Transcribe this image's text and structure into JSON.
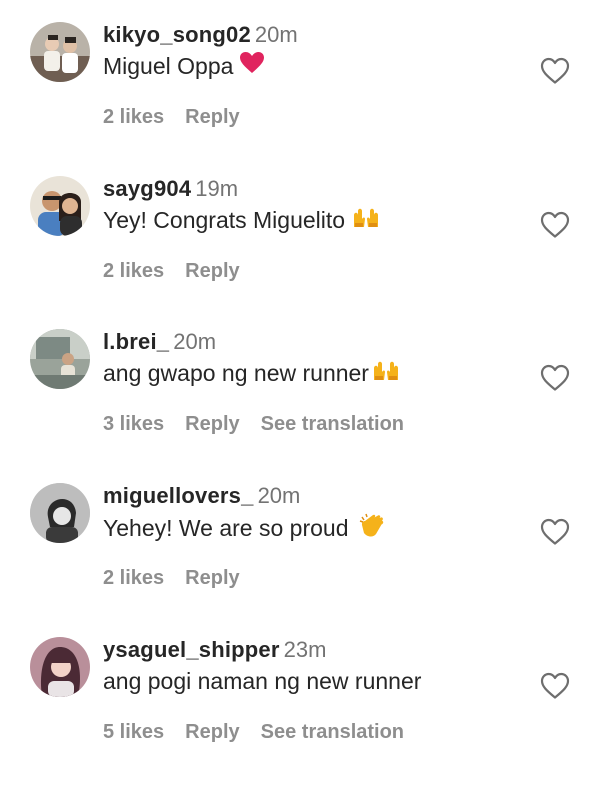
{
  "comments": [
    {
      "username": "kikyo_song02",
      "time": "20m",
      "text": "Miguel Oppa",
      "emoji": "red-heart",
      "likes": "2 likes",
      "reply": "Reply",
      "translation": ""
    },
    {
      "username": "sayg904",
      "time": "19m",
      "text": "Yey! Congrats Miguelito",
      "emoji": "raising-hands",
      "likes": "2 likes",
      "reply": "Reply",
      "translation": ""
    },
    {
      "username": "l.brei_",
      "time": "20m",
      "text": "ang gwapo ng new runner",
      "emoji": "raising-hands",
      "likes": "3 likes",
      "reply": "Reply",
      "translation": "See translation"
    },
    {
      "username": "miguellovers_",
      "time": "20m",
      "text": "Yehey! We are so proud",
      "emoji": "clapping-hands",
      "likes": "2 likes",
      "reply": "Reply",
      "translation": ""
    },
    {
      "username": "ysaguel_shipper",
      "time": "23m",
      "text": "ang pogi naman ng new runner",
      "emoji": "",
      "likes": "5 likes",
      "reply": "Reply",
      "translation": "See translation"
    }
  ],
  "colors": {
    "text": "#262626",
    "muted": "#737373",
    "meta": "#8e8e8e",
    "heart_emoji": "#e0245e",
    "hands_emoji": "#f5b21a"
  },
  "icons": {
    "like": "heart-outline-icon"
  }
}
